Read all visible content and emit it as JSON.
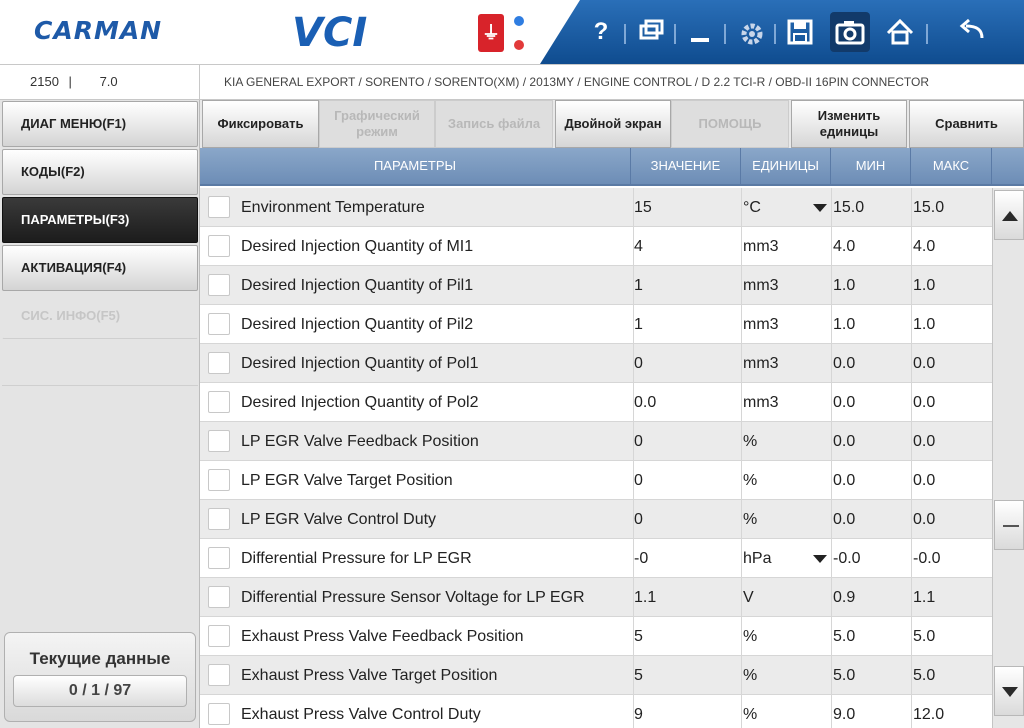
{
  "header": {
    "logo": "CARMAN",
    "product": "VCI",
    "usb_icon": "usb-icon",
    "status_dots": [
      "#2f7de1",
      "#e23a3a"
    ],
    "toolbar_icons": [
      "help-icon",
      "window-icon",
      "minimize-icon",
      "settings-icon",
      "save-icon",
      "camera-icon",
      "home-icon",
      "back-icon"
    ],
    "help_glyph": "?",
    "accent": "#1a5fb4"
  },
  "infobar": {
    "code": "2150",
    "separator": "|",
    "version": "7.0",
    "path": "KIA GENERAL EXPORT / SORENTO / SORENTO(XM) / 2013MY / ENGINE CONTROL / D 2.2 TCI-R / OBD-II 16PIN CONNECTOR"
  },
  "sidebar": {
    "items": [
      {
        "label": "ДИАГ МЕНЮ(F1)",
        "state": "normal"
      },
      {
        "label": "КОДЫ(F2)",
        "state": "normal"
      },
      {
        "label": "ПАРАМЕТРЫ(F3)",
        "state": "active"
      },
      {
        "label": "АКТИВАЦИЯ(F4)",
        "state": "normal"
      },
      {
        "label": "СИС. ИНФО(F5)",
        "state": "disabled"
      }
    ],
    "current": {
      "title": "Текущие данные",
      "count": "0 / 1 / 97"
    }
  },
  "buttons": [
    {
      "label": "Фиксировать",
      "enabled": true
    },
    {
      "label": "Графический режим",
      "enabled": false
    },
    {
      "label": "Запись файла",
      "enabled": false
    },
    {
      "label": "Двойной экран",
      "enabled": true
    },
    {
      "label": "ПОМОЩЬ",
      "enabled": false
    },
    {
      "label": "Изменить единицы",
      "enabled": true
    },
    {
      "label": "Сравнить",
      "enabled": true
    }
  ],
  "table": {
    "headers": [
      "ПАРАМЕТРЫ",
      "ЗНАЧЕНИЕ",
      "ЕДИНИЦЫ",
      "МИН",
      "МАКС"
    ],
    "rows": [
      {
        "name": "Environment Temperature",
        "value": "15",
        "unit": "°C",
        "dropdown": true,
        "min": "15.0",
        "max": "15.0"
      },
      {
        "name": "Desired Injection Quantity of MI1",
        "value": "4",
        "unit": "mm3",
        "dropdown": false,
        "min": "4.0",
        "max": "4.0"
      },
      {
        "name": "Desired Injection Quantity of Pil1",
        "value": "1",
        "unit": "mm3",
        "dropdown": false,
        "min": "1.0",
        "max": "1.0"
      },
      {
        "name": "Desired Injection Quantity of Pil2",
        "value": "1",
        "unit": "mm3",
        "dropdown": false,
        "min": "1.0",
        "max": "1.0"
      },
      {
        "name": "Desired Injection Quantity of Pol1",
        "value": "0",
        "unit": "mm3",
        "dropdown": false,
        "min": "0.0",
        "max": "0.0"
      },
      {
        "name": "Desired Injection Quantity of Pol2",
        "value": "0.0",
        "unit": "mm3",
        "dropdown": false,
        "min": "0.0",
        "max": "0.0"
      },
      {
        "name": "LP EGR Valve Feedback Position",
        "value": "0",
        "unit": "%",
        "dropdown": false,
        "min": "0.0",
        "max": "0.0"
      },
      {
        "name": "LP EGR Valve Target Position",
        "value": "0",
        "unit": "%",
        "dropdown": false,
        "min": "0.0",
        "max": "0.0"
      },
      {
        "name": "LP EGR Valve Control Duty",
        "value": "0",
        "unit": "%",
        "dropdown": false,
        "min": "0.0",
        "max": "0.0"
      },
      {
        "name": "Differential Pressure for LP EGR",
        "value": "-0",
        "unit": "hPa",
        "dropdown": true,
        "min": "-0.0",
        "max": "-0.0"
      },
      {
        "name": "Differential Pressure Sensor Voltage for LP EGR",
        "value": "1.1",
        "unit": "V",
        "dropdown": false,
        "min": "0.9",
        "max": "1.1"
      },
      {
        "name": "Exhaust Press Valve Feedback Position",
        "value": "5",
        "unit": "%",
        "dropdown": false,
        "min": "5.0",
        "max": "5.0"
      },
      {
        "name": "Exhaust Press Valve Target Position",
        "value": "5",
        "unit": "%",
        "dropdown": false,
        "min": "5.0",
        "max": "5.0"
      },
      {
        "name": "Exhaust Press Valve Control Duty",
        "value": "9",
        "unit": "%",
        "dropdown": false,
        "min": "9.0",
        "max": "12.0"
      }
    ]
  }
}
